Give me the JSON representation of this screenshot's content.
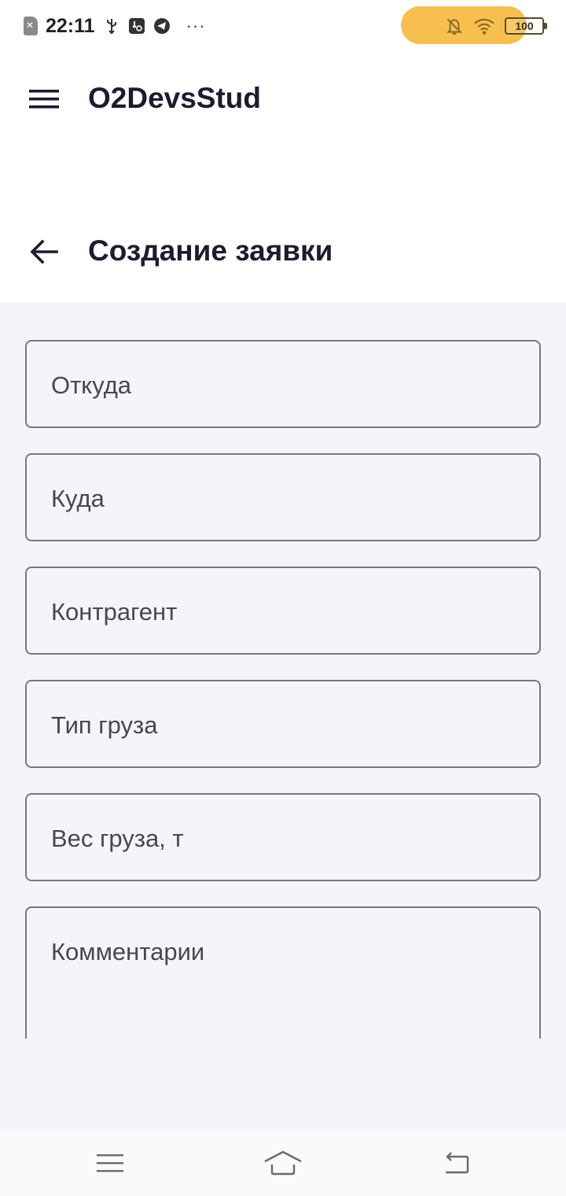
{
  "status_bar": {
    "time": "22:11",
    "dots": "···",
    "battery": "100",
    "pill_color": "#f7bf4f"
  },
  "app_bar": {
    "title": "O2DevsStud"
  },
  "page": {
    "title": "Создание заявки"
  },
  "form": {
    "fields": [
      {
        "label": "Откуда"
      },
      {
        "label": "Куда"
      },
      {
        "label": "Контрагент"
      },
      {
        "label": "Тип груза"
      },
      {
        "label": "Вес груза, т"
      },
      {
        "label": "Комментарии"
      }
    ]
  },
  "colors": {
    "content_bg": "#f5f4fa",
    "field_border": "#79767f",
    "title_text": "#1d1b2e"
  }
}
